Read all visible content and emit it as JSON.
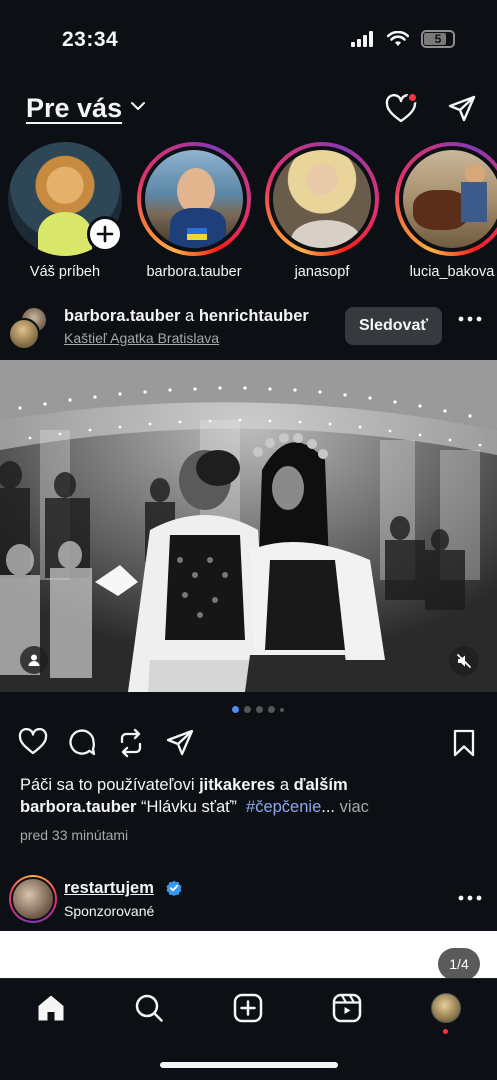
{
  "status_bar": {
    "time": "23:34",
    "battery": "5"
  },
  "header": {
    "title": "Pre vás",
    "icons": [
      "chevron-down-icon",
      "heart-icon",
      "send-icon"
    ]
  },
  "stories": [
    {
      "label": "Váš príbeh",
      "own": true
    },
    {
      "label": "barbora.tauber"
    },
    {
      "label": "janasopf"
    },
    {
      "label": "lucia_bakova"
    }
  ],
  "post": {
    "user1": "barbora.tauber",
    "conjunction": " a ",
    "user2": "henrichtauber",
    "location": "Kaštieľ Agatka Bratislava",
    "follow_label": "Sledovať",
    "likes_prefix": "Páči sa to používateľovi ",
    "likes_user": "jitkakeres",
    "likes_mid": " a ",
    "likes_others": "ďalším",
    "caption_user": "barbora.tauber",
    "caption_text": " “Hlávku sťať”  ",
    "caption_hashtag": "#čepčenie",
    "caption_ellipsis": "... ",
    "caption_more": "viac",
    "time_ago": "pred 33 minútami",
    "carousel_count": 5,
    "carousel_active": 1
  },
  "sponsored": {
    "name": "restartujem",
    "label": "Sponzorované",
    "page_indicator": "1/4"
  },
  "colors": {
    "background": "#0c1014",
    "accent_blue": "#4f8cf7",
    "notification_red": "#ff3040",
    "hashtag": "#8da8f0"
  }
}
